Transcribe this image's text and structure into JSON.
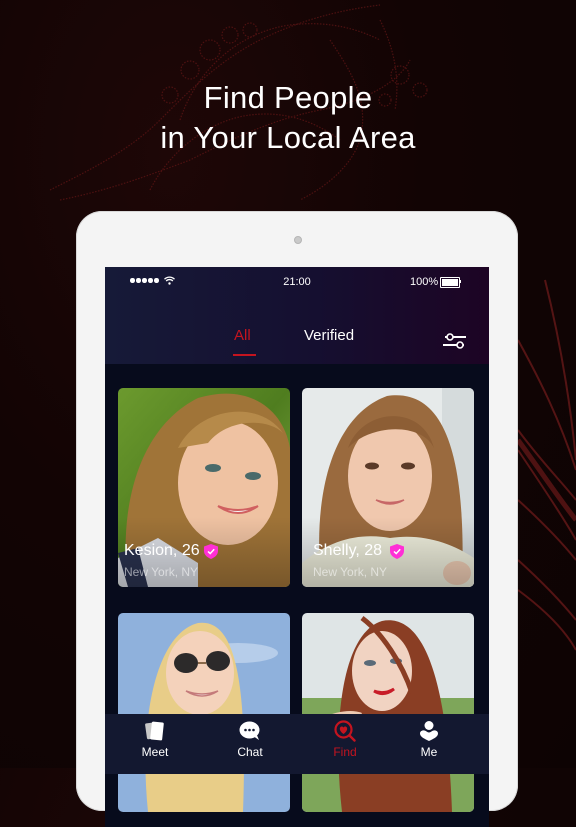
{
  "headline": {
    "line1": "Find People",
    "line2": "in Your Local Area"
  },
  "status_bar": {
    "signal_bars": 5,
    "time": "21:00",
    "battery_percent": "100%",
    "battery_level": 1.0
  },
  "top_tabs": {
    "items": [
      {
        "label": "All",
        "active": true
      },
      {
        "label": "Verified",
        "active": false
      }
    ],
    "filter_icon": "sliders-icon"
  },
  "profiles": [
    {
      "name": "Kesion, 26",
      "location": "New York, NY",
      "verified": true,
      "photo": "blonde-woman-green-background"
    },
    {
      "name": "Shelly, 28",
      "location": "New York, NY",
      "verified": true,
      "photo": "brunette-woman-light-background"
    },
    {
      "name": "",
      "location": "",
      "verified": false,
      "photo": "blonde-woman-sunglasses-sky"
    },
    {
      "name": "",
      "location": "",
      "verified": false,
      "photo": "redhead-woman-field"
    }
  ],
  "tab_bar": {
    "items": [
      {
        "label": "Meet",
        "icon": "cards-icon",
        "active": false
      },
      {
        "label": "Chat",
        "icon": "chat-bubble-icon",
        "active": false
      },
      {
        "label": "Find",
        "icon": "heart-search-icon",
        "active": true
      },
      {
        "label": "Me",
        "icon": "person-icon",
        "active": false
      }
    ]
  },
  "colors": {
    "accent": "#c4141f",
    "verified_badge": "#ff2fd6",
    "background": "#120404",
    "screen_background": "#070b1c"
  }
}
